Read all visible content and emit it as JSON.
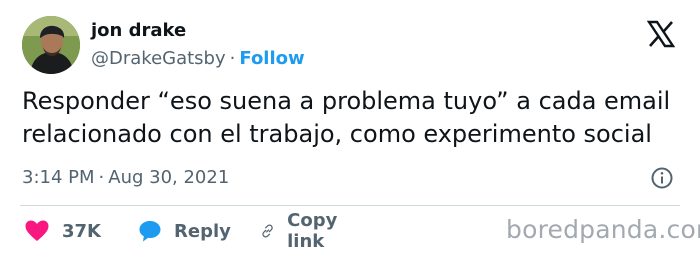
{
  "author": {
    "display_name": "jon drake",
    "handle": "@DrakeGatsby",
    "separator": "·",
    "follow_label": "Follow"
  },
  "tweet": {
    "text_lines": [
      "Responder “eso suena a problema tuyo” a cada email",
      "relacionado con el trabajo, como experimento social"
    ],
    "time": "3:14 PM",
    "separator": "·",
    "date": "Aug 30, 2021"
  },
  "actions": {
    "like_count": "37K",
    "reply_label": "Reply",
    "copy_link_label": "Copy link"
  },
  "icons": {
    "platform": "x-logo-icon",
    "info": "info-icon",
    "like": "heart-icon",
    "reply": "speech-bubble-icon",
    "copy_link": "link-icon"
  },
  "colors": {
    "follow": "#1d9bf0",
    "like": "#f91880",
    "reply": "#1d9bf0",
    "secondary_text": "#536471"
  },
  "watermark": "boredpanda.com"
}
